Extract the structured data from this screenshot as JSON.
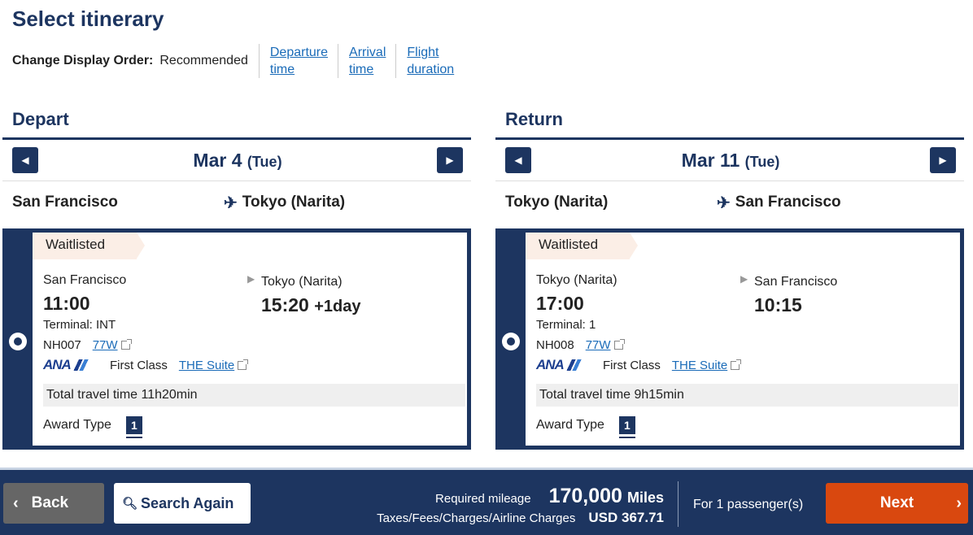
{
  "page_title": "Select itinerary",
  "display_order": {
    "label": "Change Display Order:",
    "current": "Recommended",
    "options": [
      [
        "Departure",
        "time"
      ],
      [
        "Arrival",
        "time"
      ],
      [
        "Flight",
        "duration"
      ]
    ]
  },
  "depart": {
    "heading": "Depart",
    "date": "Mar 4",
    "dow": "(Tue)",
    "from": "San Francisco",
    "to": "Tokyo (Narita)",
    "status": "Waitlisted",
    "dep_city": "San Francisco",
    "dep_time": "11:00",
    "arr_city": "Tokyo (Narita)",
    "arr_time": "15:20",
    "arr_plus": "+1day",
    "terminal": "Terminal: INT",
    "flight_no": "NH007",
    "aircraft": "77W",
    "airline_logo": "ANA",
    "cabin": "First Class",
    "seat": "THE Suite",
    "travel_time": "Total travel time 11h20min",
    "award_label": "Award Type",
    "award_value": "1"
  },
  "return": {
    "heading": "Return",
    "date": "Mar 11",
    "dow": "(Tue)",
    "from": "Tokyo (Narita)",
    "to": "San Francisco",
    "status": "Waitlisted",
    "dep_city": "Tokyo (Narita)",
    "dep_time": "17:00",
    "arr_city": "San Francisco",
    "arr_time": "10:15",
    "arr_plus": "",
    "terminal": "Terminal: 1",
    "flight_no": "NH008",
    "aircraft": "77W",
    "airline_logo": "ANA",
    "cabin": "First Class",
    "seat": "THE Suite",
    "travel_time": "Total travel time 9h15min",
    "award_label": "Award Type",
    "award_value": "1"
  },
  "footer": {
    "back": "Back",
    "search_again": "Search Again",
    "mileage_label": "Required mileage",
    "mileage_value": "170,000",
    "mileage_unit": "Miles",
    "taxes_label": "Taxes/Fees/Charges/Airline Charges",
    "taxes_value": "USD  367.71",
    "passengers": "For 1 passenger(s)",
    "next": "Next"
  },
  "colors": {
    "navy": "#1d3560",
    "link": "#1a6bb8",
    "next": "#d9480f",
    "waitlisted_bg": "#fbeee6"
  }
}
